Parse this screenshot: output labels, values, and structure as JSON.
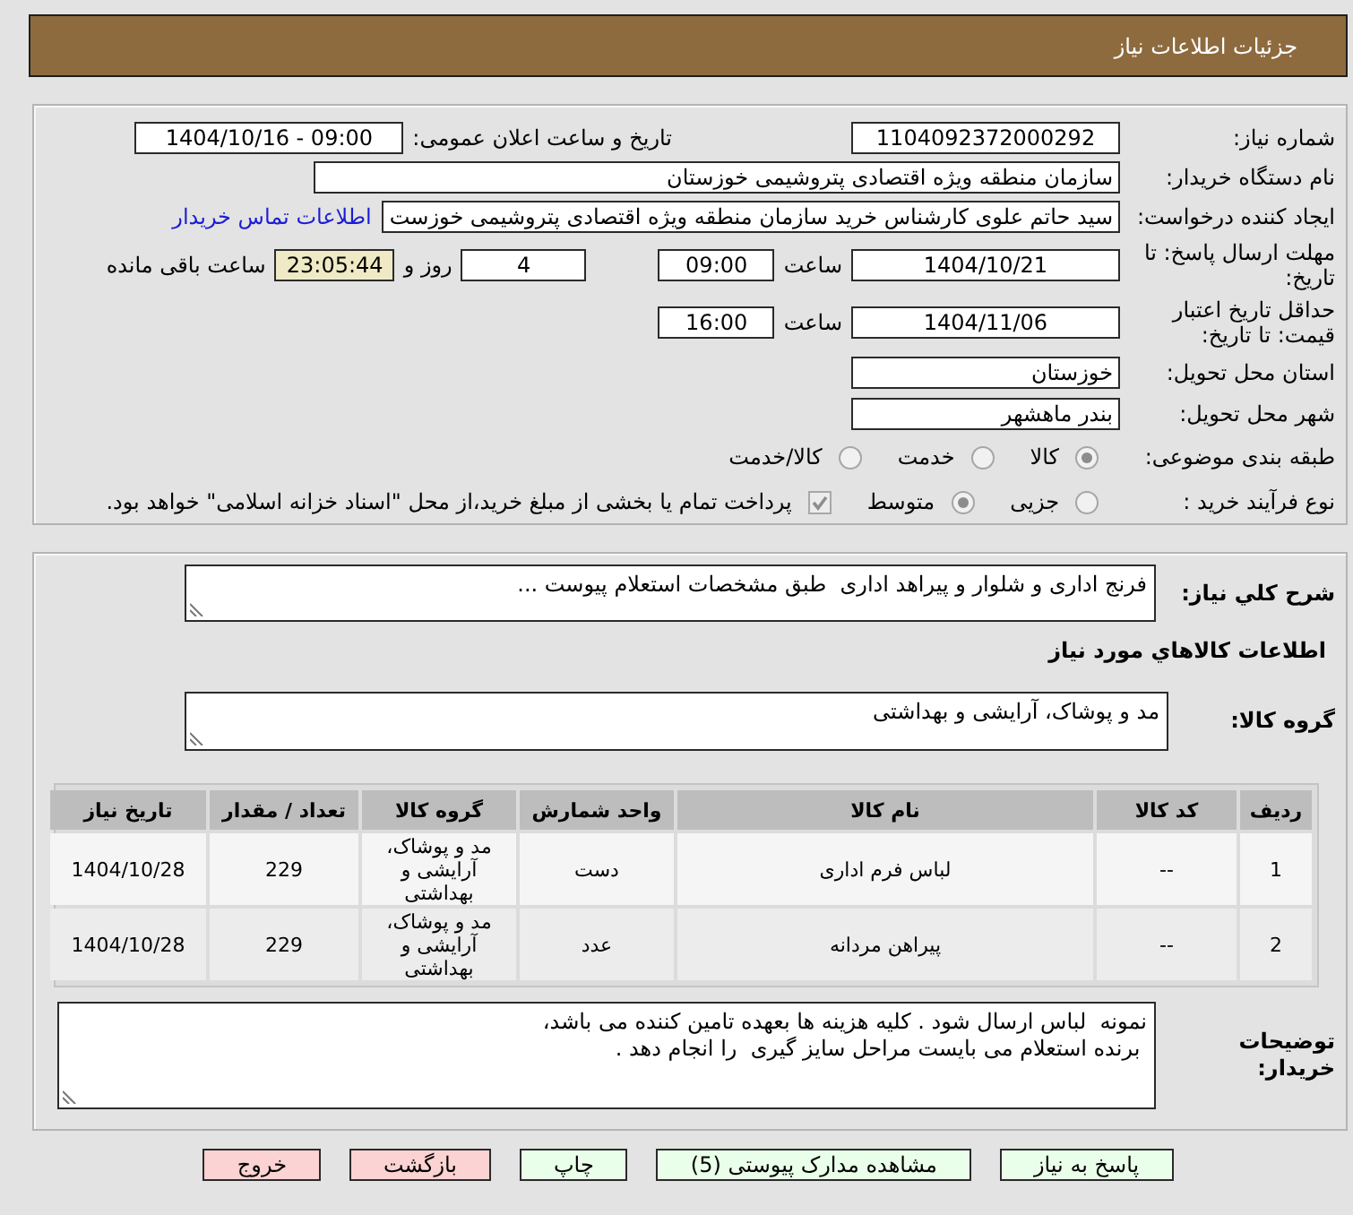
{
  "header": {
    "title": "جزئیات اطلاعات نیاز"
  },
  "need_info": {
    "need_number": {
      "label": "شماره نیاز:",
      "value": "1104092372000292"
    },
    "announcement": {
      "label": "تاریخ و ساعت اعلان عمومی:",
      "value": "1404/10/16 - 09:00"
    },
    "buyer_org": {
      "label": "نام دستگاه خریدار:",
      "value": "سازمان منطقه ویژه اقتصادی پتروشیمی خوزستان"
    },
    "requester": {
      "label": "ایجاد کننده درخواست:",
      "value": "سید حاتم علوی کارشناس خرید سازمان منطقه ویژه اقتصادی پتروشیمی خوزست",
      "contact_link": "اطلاعات تماس خریدار"
    },
    "reply_deadline": {
      "label": "مهلت ارسال پاسخ: تا تاریخ:",
      "date": "1404/10/21",
      "time_label": "ساعت",
      "time": "09:00",
      "days": "4",
      "days_label": "روز و",
      "remaining": "23:05:44",
      "remaining_label": "ساعت باقی مانده"
    },
    "price_validity": {
      "label": "حداقل تاریخ اعتبار قیمت: تا تاریخ:",
      "date": "1404/11/06",
      "time_label": "ساعت",
      "time": "16:00"
    },
    "delivery_province": {
      "label": "استان محل تحویل:",
      "value": "خوزستان"
    },
    "delivery_city": {
      "label": "شهر محل تحویل:",
      "value": "بندر ماهشهر"
    },
    "subject_category": {
      "label": "طبقه بندی موضوعی:",
      "options": [
        {
          "label": "کالا",
          "selected": true
        },
        {
          "label": "خدمت",
          "selected": false
        },
        {
          "label": "کالا/خدمت",
          "selected": false
        }
      ]
    },
    "purchase_process": {
      "label": "نوع فرآیند خرید :",
      "options": [
        {
          "label": "جزیی",
          "selected": false
        },
        {
          "label": "متوسط",
          "selected": true
        }
      ],
      "treasury_payment": {
        "label": "پرداخت تمام یا بخشی از مبلغ خرید،از محل \"اسناد خزانه اسلامی\" خواهد بود.",
        "checked": true
      }
    }
  },
  "need_items": {
    "summary": {
      "label": "شرح کلي نیاز:",
      "value": "فرنج اداری و شلوار و پیراهد اداری  طبق مشخصات استعلام پیوست ..."
    },
    "section_title": "اطلاعات کالاهاي مورد نیاز",
    "goods_group": {
      "label": "گروه کالا:",
      "value": "مد و پوشاک، آرایشی و بهداشتی"
    },
    "table": {
      "columns": [
        "ردیف",
        "کد کالا",
        "نام کالا",
        "واحد شمارش",
        "گروه کالا",
        "تعداد / مقدار",
        "تاریخ نیاز"
      ],
      "rows": [
        [
          "1",
          "--",
          "لباس فرم اداری",
          "دست",
          "مد و پوشاک، آرایشی و بهداشتی",
          "229",
          "1404/10/28"
        ],
        [
          "2",
          "--",
          "پیراهن مردانه",
          "عدد",
          "مد و پوشاک، آرایشی و بهداشتی",
          "229",
          "1404/10/28"
        ]
      ]
    },
    "buyer_notes": {
      "label": "توضیحات خریدار:",
      "value": "نمونه  لباس ارسال شود . کلیه هزینه ها بعهده تامین کننده می باشد،\n برنده استعلام می بایست مراحل سایز گیری  را انجام دهد ."
    }
  },
  "buttons": [
    {
      "label": "پاسخ به نیاز",
      "kind": "action"
    },
    {
      "label": "مشاهده مدارک پیوستی (5)",
      "kind": "action"
    },
    {
      "label": "چاپ",
      "kind": "action"
    },
    {
      "label": "بازگشت",
      "kind": "exit"
    },
    {
      "label": "خروج",
      "kind": "exit"
    }
  ]
}
